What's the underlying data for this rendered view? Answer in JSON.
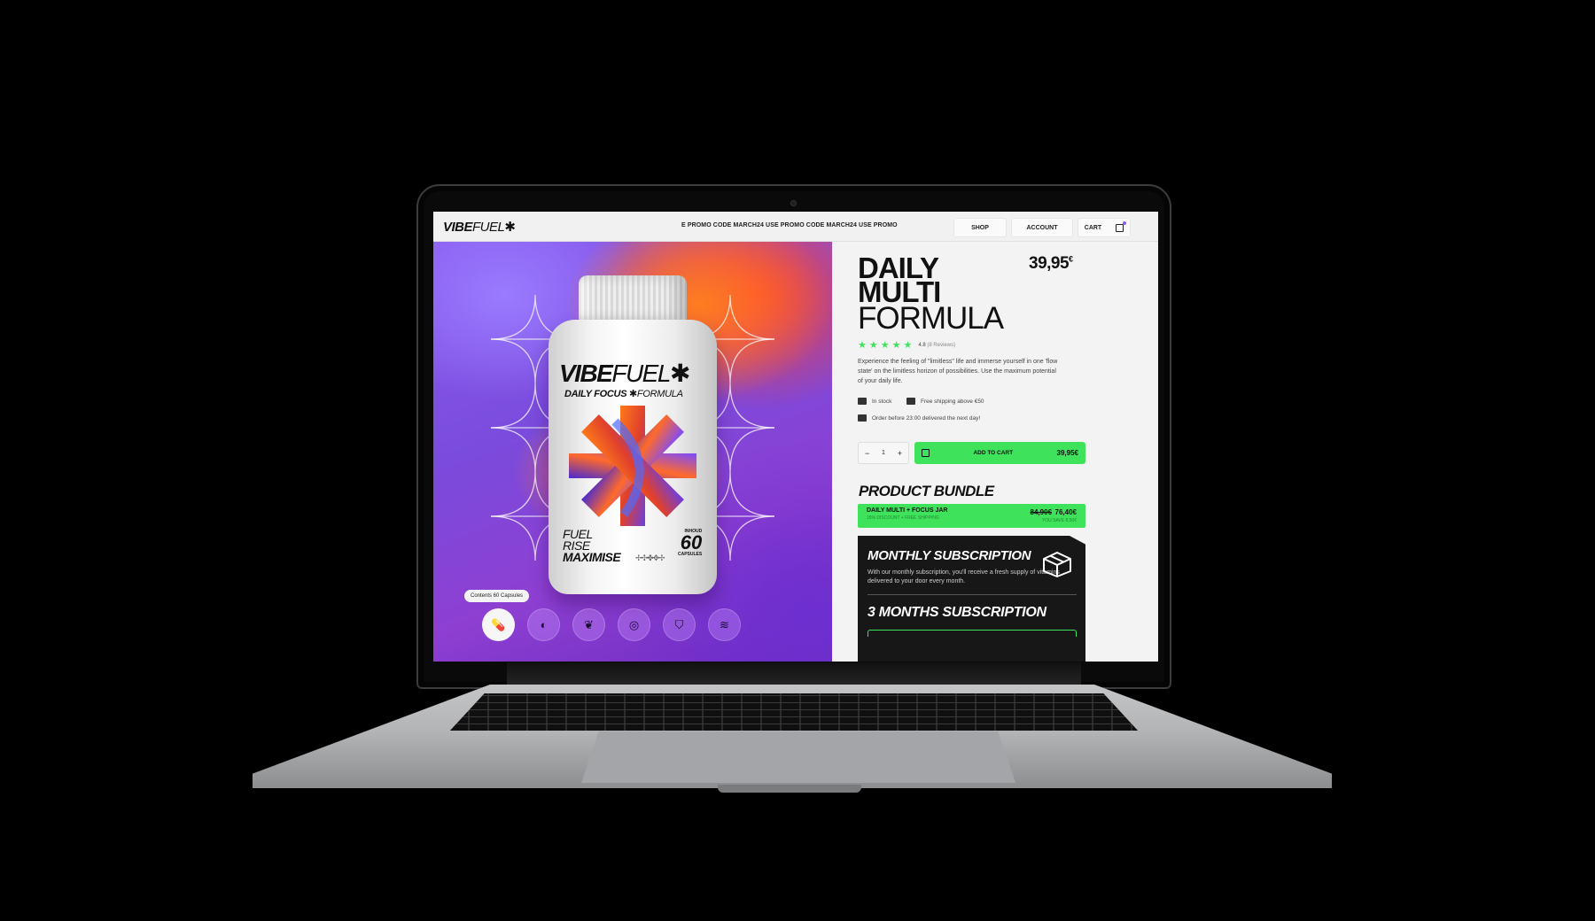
{
  "brand": {
    "name_bold": "VIBE",
    "name_thin": "FUEL",
    "mark": "✱"
  },
  "header": {
    "promo_text": "E PROMO CODE MARCH24   USE PROMO CODE MARCH24   USE PROMO",
    "nav": {
      "shop": "SHOP",
      "account": "ACCOUNT",
      "cart": "CART"
    }
  },
  "hero": {
    "bottle": {
      "brand_bold": "VIBE",
      "brand_thin": "FUEL",
      "mark": "✱",
      "subtitle_bold": "DAILY FOCUS ✱",
      "subtitle_thin": "FORMULA",
      "tag_line1": "FUEL",
      "tag_line2": "RISE",
      "tag_line3": "MAXIMISE",
      "count_label": "INHOUD",
      "count": "60",
      "count_unit": "CAPSULES"
    },
    "tooltip": "Contents 60 Capsules",
    "thumbnails": [
      {
        "icon": "capsule-icon",
        "glyph": "💊"
      },
      {
        "icon": "leaf-ring-icon",
        "glyph": "◐"
      },
      {
        "icon": "plant-icon",
        "glyph": "❦"
      },
      {
        "icon": "target-icon",
        "glyph": "◎"
      },
      {
        "icon": "shield-icon",
        "glyph": "⛉"
      },
      {
        "icon": "waves-icon",
        "glyph": "≋"
      }
    ]
  },
  "product": {
    "title_line1": "DAILY",
    "title_line2": "MULTI",
    "title_line3": "FORMULA",
    "price": "39,95",
    "currency": "€",
    "rating": "4.8",
    "reviews": "(8 Reviews)",
    "description": "Experience the feeling of \"limitless\" life and immerse yourself in one 'flow state' on the limitless horizon of possibilities. Use the maximum potential of your daily life.",
    "features": [
      "In stock",
      "Free shipping above €50",
      "Order before 23:00 delivered the next day!"
    ],
    "quantity": "1",
    "qty_minus": "−",
    "qty_plus": "+",
    "add_to_cart": "ADD TO CART",
    "add_to_cart_price": "39,95€"
  },
  "bundle": {
    "heading": "PRODUCT BUNDLE",
    "name": "DAILY MULTI + FOCUS JAR",
    "note": "15% DISCOUNT + FREE SHIPPING",
    "old_price": "84,90€",
    "new_price": "76,40€",
    "saving": "YOU SAVE 8,50€"
  },
  "subscription": {
    "heading": "MONTHLY SUBSCRIPTION",
    "text": "With our monthly subscription, you'll receive a fresh supply of vitamins delivered to your door every month.",
    "plan": "3 MONTHS SUBSCRIPTION"
  },
  "colors": {
    "accent_green": "#3fe25b",
    "accent_purple": "#8b5cf6",
    "dark_card": "#171717"
  }
}
